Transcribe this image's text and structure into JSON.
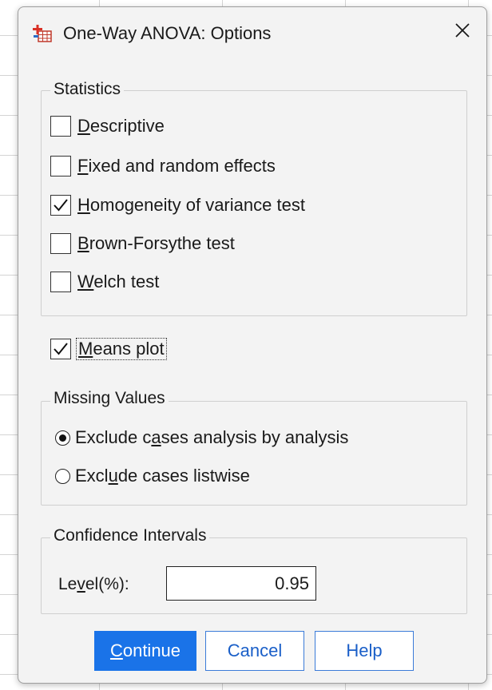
{
  "dialog": {
    "title": "One-Way ANOVA: Options",
    "app_icon": "spss-anova-icon",
    "close_icon": "close-icon"
  },
  "statistics": {
    "group_label": "Statistics",
    "items": [
      {
        "pre": "",
        "key": "D",
        "post": "escriptive",
        "checked": false
      },
      {
        "pre": "",
        "key": "F",
        "post": "ixed and random effects",
        "checked": false
      },
      {
        "pre": "",
        "key": "H",
        "post": "omogeneity of variance test",
        "checked": true
      },
      {
        "pre": "",
        "key": "B",
        "post": "rown-Forsythe test",
        "checked": false
      },
      {
        "pre": "",
        "key": "W",
        "post": "elch test",
        "checked": false
      }
    ]
  },
  "means_plot": {
    "pre": "",
    "key": "M",
    "post": "eans plot",
    "checked": true
  },
  "missing_values": {
    "group_label": "Missing Values",
    "options": [
      {
        "pre": "Exclude c",
        "key": "a",
        "post": "ses analysis by analysis",
        "selected": true
      },
      {
        "pre": "Excl",
        "key": "u",
        "post": "de cases listwise",
        "selected": false
      }
    ]
  },
  "confidence": {
    "group_label": "Confidence Intervals",
    "level_pre": "Le",
    "level_key": "v",
    "level_post": "el(%):",
    "level_value": "0.95"
  },
  "buttons": {
    "continue_key": "C",
    "continue_post": "ontinue",
    "cancel": "Cancel",
    "help": "Help"
  },
  "colors": {
    "primary": "#1a73e8",
    "dialog_bg": "#f3f3f3"
  }
}
